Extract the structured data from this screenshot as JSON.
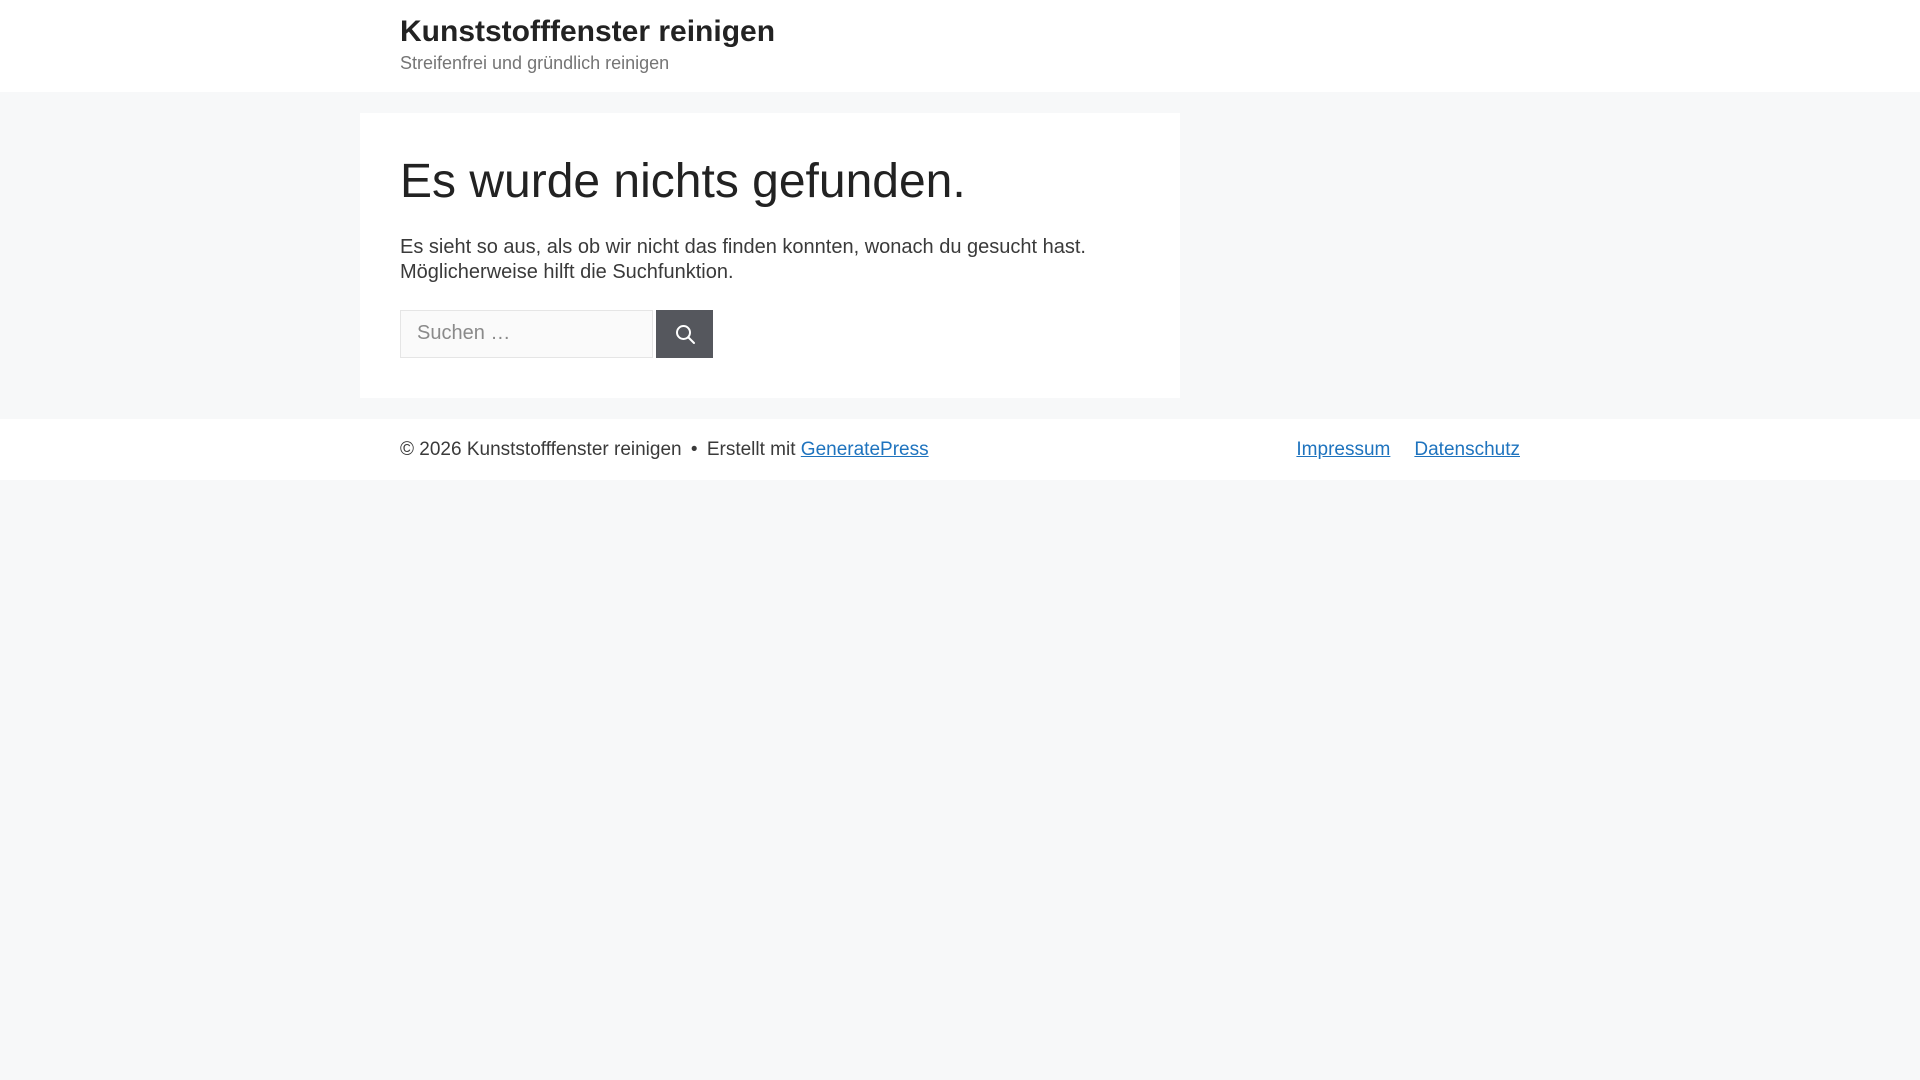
{
  "site": {
    "title": "Kunststofffenster reinigen",
    "tagline": "Streifenfrei und gründlich reinigen"
  },
  "main": {
    "heading": "Es wurde nichts gefunden.",
    "message": "Es sieht so aus, als ob wir nicht das finden konnten, wonach du gesucht hast. Möglicherweise hilft die Suchfunktion.",
    "search": {
      "placeholder": "Suchen …",
      "value": "",
      "button_icon": "search-icon"
    }
  },
  "footer": {
    "copyright": "© 2026 Kunststofffenster reinigen",
    "separator": "•",
    "credit_prefix": "Erstellt mit",
    "credit_link_label": "GeneratePress",
    "links": [
      {
        "label": "Impressum"
      },
      {
        "label": "Datenschutz"
      }
    ]
  },
  "colors": {
    "page_background": "#f7f8f9",
    "surface": "#ffffff",
    "title_text": "#222222",
    "tagline_text": "#757575",
    "body_text": "#3a3a3a",
    "link": "#1e73be",
    "search_button_background": "#55575d",
    "search_input_background": "#fafafa",
    "search_input_border": "#e5e5e5",
    "placeholder_text": "#8a8a8a"
  }
}
